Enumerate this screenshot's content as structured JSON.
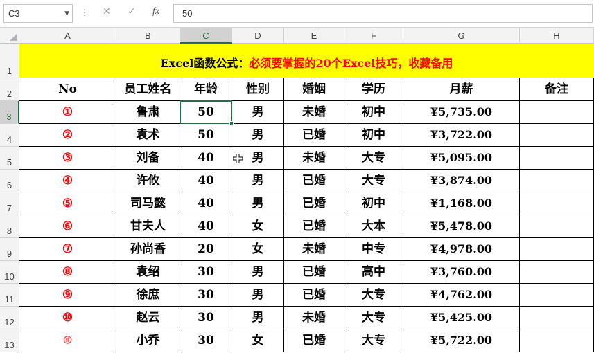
{
  "name_box": "C3",
  "formula_value": "50",
  "formula_icons": [
    "cancel-icon",
    "enter-icon",
    "function-icon"
  ],
  "fx_label": "fx",
  "separator_glyph": "⋮",
  "columns": [
    "A",
    "B",
    "C",
    "D",
    "E",
    "F",
    "G",
    "H"
  ],
  "selected_column": "C",
  "rows": [
    "1",
    "2",
    "3",
    "4",
    "5",
    "6",
    "7",
    "8",
    "9",
    "10",
    "11",
    "12",
    "13"
  ],
  "selected_row": "3",
  "title": {
    "part_black": "Excel函数公式：",
    "part_red": "必须要掌握的20个Excel技巧，收藏备用"
  },
  "headers": [
    "No",
    "员工姓名",
    "年龄",
    "性别",
    "婚姻",
    "学历",
    "月薪",
    "备注"
  ],
  "records": [
    {
      "no": "①",
      "name": "鲁肃",
      "age": "50",
      "gender": "男",
      "marital": "未婚",
      "edu": "初中",
      "salary": "¥5,735.00",
      "note": ""
    },
    {
      "no": "②",
      "name": "袁术",
      "age": "50",
      "gender": "男",
      "marital": "已婚",
      "edu": "初中",
      "salary": "¥3,722.00",
      "note": ""
    },
    {
      "no": "③",
      "name": "刘备",
      "age": "40",
      "gender": "男",
      "marital": "未婚",
      "edu": "大专",
      "salary": "¥5,095.00",
      "note": ""
    },
    {
      "no": "④",
      "name": "许攸",
      "age": "40",
      "gender": "男",
      "marital": "已婚",
      "edu": "大专",
      "salary": "¥3,874.00",
      "note": ""
    },
    {
      "no": "⑤",
      "name": "司马懿",
      "age": "40",
      "gender": "男",
      "marital": "已婚",
      "edu": "初中",
      "salary": "¥1,168.00",
      "note": ""
    },
    {
      "no": "⑥",
      "name": "甘夫人",
      "age": "40",
      "gender": "女",
      "marital": "已婚",
      "edu": "大本",
      "salary": "¥5,478.00",
      "note": ""
    },
    {
      "no": "⑦",
      "name": "孙尚香",
      "age": "20",
      "gender": "女",
      "marital": "未婚",
      "edu": "中专",
      "salary": "¥4,978.00",
      "note": ""
    },
    {
      "no": "⑧",
      "name": "袁绍",
      "age": "30",
      "gender": "男",
      "marital": "已婚",
      "edu": "高中",
      "salary": "¥3,760.00",
      "note": ""
    },
    {
      "no": "⑨",
      "name": "徐庶",
      "age": "30",
      "gender": "男",
      "marital": "已婚",
      "edu": "大专",
      "salary": "¥4,762.00",
      "note": ""
    },
    {
      "no": "⑩",
      "name": "赵云",
      "age": "30",
      "gender": "男",
      "marital": "未婚",
      "edu": "大专",
      "salary": "¥5,425.00",
      "note": ""
    },
    {
      "no": "⑪",
      "name": "小乔",
      "age": "30",
      "gender": "女",
      "marital": "已婚",
      "edu": "大专",
      "salary": "¥5,722.00",
      "note": ""
    }
  ],
  "colors": {
    "title_fill": "#ffff00",
    "title_red": "#ff0000",
    "selection_green": "#217346",
    "number_red": "#ff0000"
  }
}
